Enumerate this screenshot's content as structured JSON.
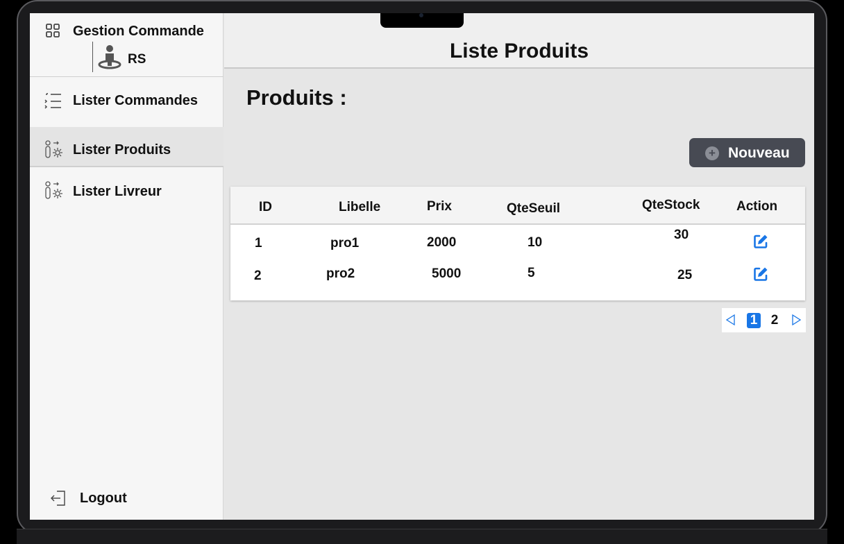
{
  "app": {
    "brand_title": "Gestion Commande",
    "user_label": "RS"
  },
  "sidebar": {
    "items": [
      {
        "label": "Lister Commandes",
        "icon": "list-icon",
        "active": false
      },
      {
        "label": "Lister Produits",
        "icon": "person-gear-icon",
        "active": true
      },
      {
        "label": "Lister Livreur",
        "icon": "person-gear-icon",
        "active": false
      }
    ],
    "logout_label": "Logout"
  },
  "header": {
    "page_title": "Liste Produits"
  },
  "main": {
    "section_title": "Produits :",
    "new_button_label": "Nouveau"
  },
  "table": {
    "headers": [
      "ID",
      "Libelle",
      "Prix",
      "QteSeuil",
      "QteStock",
      "Action"
    ],
    "rows": [
      [
        "1",
        "pro1",
        "2000",
        "10",
        "30"
      ],
      [
        "2",
        "pro2",
        "5000",
        "5",
        "25"
      ]
    ]
  },
  "pagination": {
    "pages": [
      "1",
      "2"
    ],
    "current": "1"
  },
  "colors": {
    "accent": "#1976e6",
    "button_bg": "#474a53"
  }
}
